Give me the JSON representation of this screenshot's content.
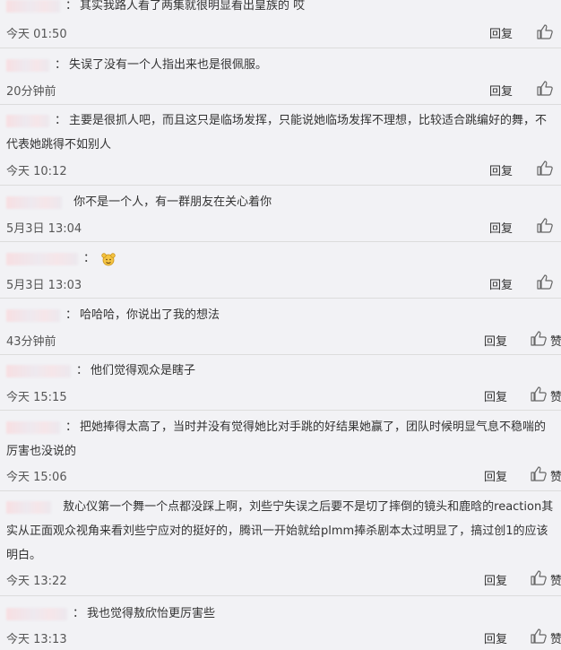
{
  "reply_label": "回复",
  "like_label": "赞",
  "comments": [
    {
      "text": "其实我路人看了两集就很明显看出皇族的 哎",
      "time": "今天 01:50"
    },
    {
      "text": "失误了没有一个人指出来也是很佩服。",
      "time": "20分钟前"
    },
    {
      "text": "主要是很抓人吧，而且这只是临场发挥，只能说她临场发挥不理想，比较适合跳编好的舞，不代表她跳得不如别人",
      "time": "今天 10:12"
    },
    {
      "text": "你不是一个人，有一群朋友在关心着你",
      "time": "5月3日 13:04"
    },
    {
      "text": "",
      "emoji": "cheering-emoji-icon",
      "time": "5月3日 13:03"
    },
    {
      "text": "哈哈哈，你说出了我的想法",
      "time": "43分钟前"
    },
    {
      "text": "他们觉得观众是瞎子",
      "time": "今天 15:15"
    },
    {
      "text": "把她捧得太高了，当时并没有觉得她比对手跳的好结果她赢了，团队时候明显气息不稳喘的厉害也没说的",
      "time": "今天 15:06"
    },
    {
      "text": "敖心仪第一个舞一个点都没踩上啊，刘些宁失误之后要不是切了摔倒的镜头和鹿晗的reaction其实从正面观众视角来看刘些宁应对的挺好的，腾讯一开始就给plmm捧杀剧本太过明显了，搞过创1的应该明白。",
      "time": "今天 13:22"
    },
    {
      "text": "我也觉得敖欣怡更厉害些",
      "time": "今天 13:13"
    }
  ]
}
